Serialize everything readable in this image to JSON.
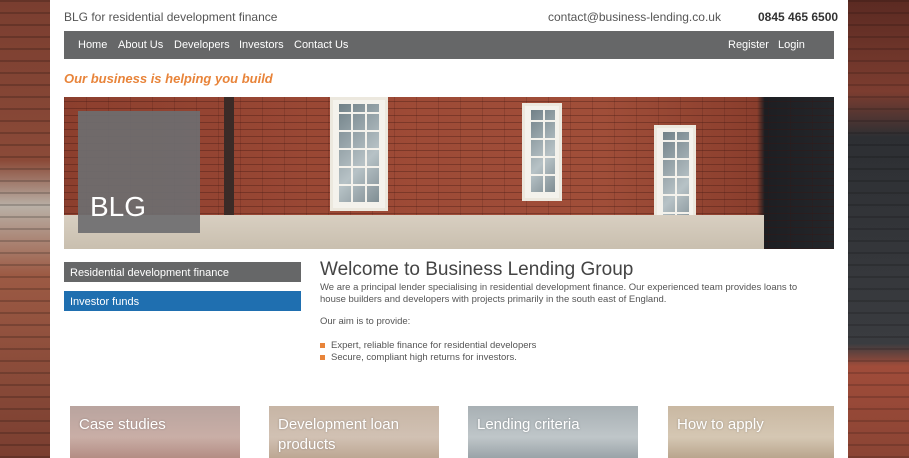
{
  "header": {
    "tagline": "BLG for residential development finance",
    "email": "contact@business-lending.co.uk",
    "phone": "0845 465 6500"
  },
  "nav": {
    "items": [
      "Home",
      "About Us",
      "Developers",
      "Investors",
      "Contact Us"
    ],
    "register": "Register",
    "login": "Login"
  },
  "slogan": "Our business is helping you build",
  "hero": {
    "logo_text": "BLG"
  },
  "sidebar": {
    "items": [
      "Residential development finance",
      "Investor funds"
    ]
  },
  "welcome": {
    "title": "Welcome to Business Lending Group",
    "text": "We are a principal lender specialising in residential development finance. Our experienced team provides loans to house builders and developers with projects primarily in the south east of England.",
    "aim": "Our aim is to provide:",
    "bullets": [
      "Expert, reliable finance for residential developers",
      "Secure, compliant high returns for investors."
    ]
  },
  "tiles": [
    "Case studies",
    "Development loan products",
    "Lending criteria",
    "How to apply"
  ],
  "colors": {
    "orange": "#e8843a",
    "nav_grey": "#666768",
    "blue": "#1f6fb0"
  }
}
